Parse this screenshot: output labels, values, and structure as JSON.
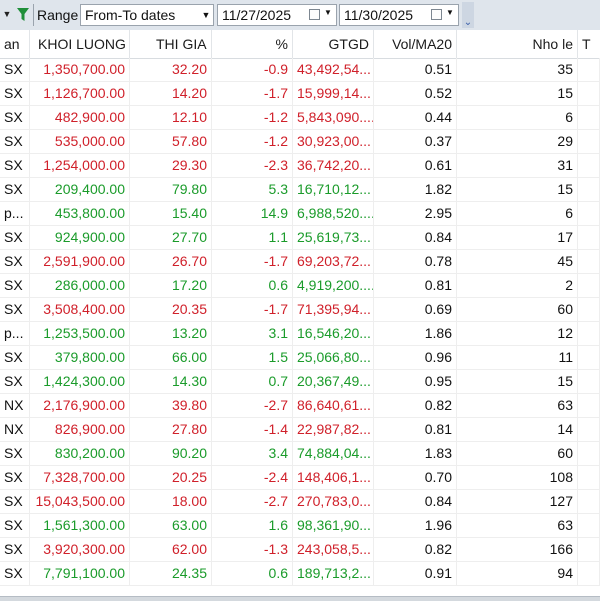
{
  "toolbar": {
    "range_label": "Range",
    "range_value": "From-To dates",
    "from_date": "11/27/2025",
    "to_date": "11/30/2025",
    "more_glyph": "⌄"
  },
  "columns": [
    "an",
    "KHOI LUONG",
    "THI GIA",
    "%",
    "GTGD",
    "Vol/MA20",
    "Nho le",
    "T"
  ],
  "colors": {
    "up": "#1a9b2a",
    "down": "#d0202a",
    "neutral": "#111111"
  },
  "rows": [
    {
      "exchange": "SX",
      "volume": "1,350,700.00",
      "price": "32.20",
      "pct": "-0.9",
      "value": "43,492,54...",
      "vol_ma20": "0.51",
      "odd_lot": "35",
      "trend": "down"
    },
    {
      "exchange": "SX",
      "volume": "1,126,700.00",
      "price": "14.20",
      "pct": "-1.7",
      "value": "15,999,14...",
      "vol_ma20": "0.52",
      "odd_lot": "15",
      "trend": "down"
    },
    {
      "exchange": "SX",
      "volume": "482,900.00",
      "price": "12.10",
      "pct": "-1.2",
      "value": "5,843,090....",
      "vol_ma20": "0.44",
      "odd_lot": "6",
      "trend": "down"
    },
    {
      "exchange": "SX",
      "volume": "535,000.00",
      "price": "57.80",
      "pct": "-1.2",
      "value": "30,923,00...",
      "vol_ma20": "0.37",
      "odd_lot": "29",
      "trend": "down"
    },
    {
      "exchange": "SX",
      "volume": "1,254,000.00",
      "price": "29.30",
      "pct": "-2.3",
      "value": "36,742,20...",
      "vol_ma20": "0.61",
      "odd_lot": "31",
      "trend": "down"
    },
    {
      "exchange": "SX",
      "volume": "209,400.00",
      "price": "79.80",
      "pct": "5.3",
      "value": "16,710,12...",
      "vol_ma20": "1.82",
      "odd_lot": "15",
      "trend": "up"
    },
    {
      "exchange": "p...",
      "volume": "453,800.00",
      "price": "15.40",
      "pct": "14.9",
      "value": "6,988,520....",
      "vol_ma20": "2.95",
      "odd_lot": "6",
      "trend": "up"
    },
    {
      "exchange": "SX",
      "volume": "924,900.00",
      "price": "27.70",
      "pct": "1.1",
      "value": "25,619,73...",
      "vol_ma20": "0.84",
      "odd_lot": "17",
      "trend": "up"
    },
    {
      "exchange": "SX",
      "volume": "2,591,900.00",
      "price": "26.70",
      "pct": "-1.7",
      "value": "69,203,72...",
      "vol_ma20": "0.78",
      "odd_lot": "45",
      "trend": "down"
    },
    {
      "exchange": "SX",
      "volume": "286,000.00",
      "price": "17.20",
      "pct": "0.6",
      "value": "4,919,200....",
      "vol_ma20": "0.81",
      "odd_lot": "2",
      "trend": "up"
    },
    {
      "exchange": "SX",
      "volume": "3,508,400.00",
      "price": "20.35",
      "pct": "-1.7",
      "value": "71,395,94...",
      "vol_ma20": "0.69",
      "odd_lot": "60",
      "trend": "down"
    },
    {
      "exchange": "p...",
      "volume": "1,253,500.00",
      "price": "13.20",
      "pct": "3.1",
      "value": "16,546,20...",
      "vol_ma20": "1.86",
      "odd_lot": "12",
      "trend": "up"
    },
    {
      "exchange": "SX",
      "volume": "379,800.00",
      "price": "66.00",
      "pct": "1.5",
      "value": "25,066,80...",
      "vol_ma20": "0.96",
      "odd_lot": "11",
      "trend": "up"
    },
    {
      "exchange": "SX",
      "volume": "1,424,300.00",
      "price": "14.30",
      "pct": "0.7",
      "value": "20,367,49...",
      "vol_ma20": "0.95",
      "odd_lot": "15",
      "trend": "up"
    },
    {
      "exchange": "NX",
      "volume": "2,176,900.00",
      "price": "39.80",
      "pct": "-2.7",
      "value": "86,640,61...",
      "vol_ma20": "0.82",
      "odd_lot": "63",
      "trend": "down"
    },
    {
      "exchange": "NX",
      "volume": "826,900.00",
      "price": "27.80",
      "pct": "-1.4",
      "value": "22,987,82...",
      "vol_ma20": "0.81",
      "odd_lot": "14",
      "trend": "down"
    },
    {
      "exchange": "SX",
      "volume": "830,200.00",
      "price": "90.20",
      "pct": "3.4",
      "value": "74,884,04...",
      "vol_ma20": "1.83",
      "odd_lot": "60",
      "trend": "up"
    },
    {
      "exchange": "SX",
      "volume": "7,328,700.00",
      "price": "20.25",
      "pct": "-2.4",
      "value": "148,406,1...",
      "vol_ma20": "0.70",
      "odd_lot": "108",
      "trend": "down"
    },
    {
      "exchange": "SX",
      "volume": "15,043,500.00",
      "price": "18.00",
      "pct": "-2.7",
      "value": "270,783,0...",
      "vol_ma20": "0.84",
      "odd_lot": "127",
      "trend": "down"
    },
    {
      "exchange": "SX",
      "volume": "1,561,300.00",
      "price": "63.00",
      "pct": "1.6",
      "value": "98,361,90...",
      "vol_ma20": "1.96",
      "odd_lot": "63",
      "trend": "up"
    },
    {
      "exchange": "SX",
      "volume": "3,920,300.00",
      "price": "62.00",
      "pct": "-1.3",
      "value": "243,058,5...",
      "vol_ma20": "0.82",
      "odd_lot": "166",
      "trend": "down"
    },
    {
      "exchange": "SX",
      "volume": "7,791,100.00",
      "price": "24.35",
      "pct": "0.6",
      "value": "189,713,2...",
      "vol_ma20": "0.91",
      "odd_lot": "94",
      "trend": "up"
    }
  ]
}
